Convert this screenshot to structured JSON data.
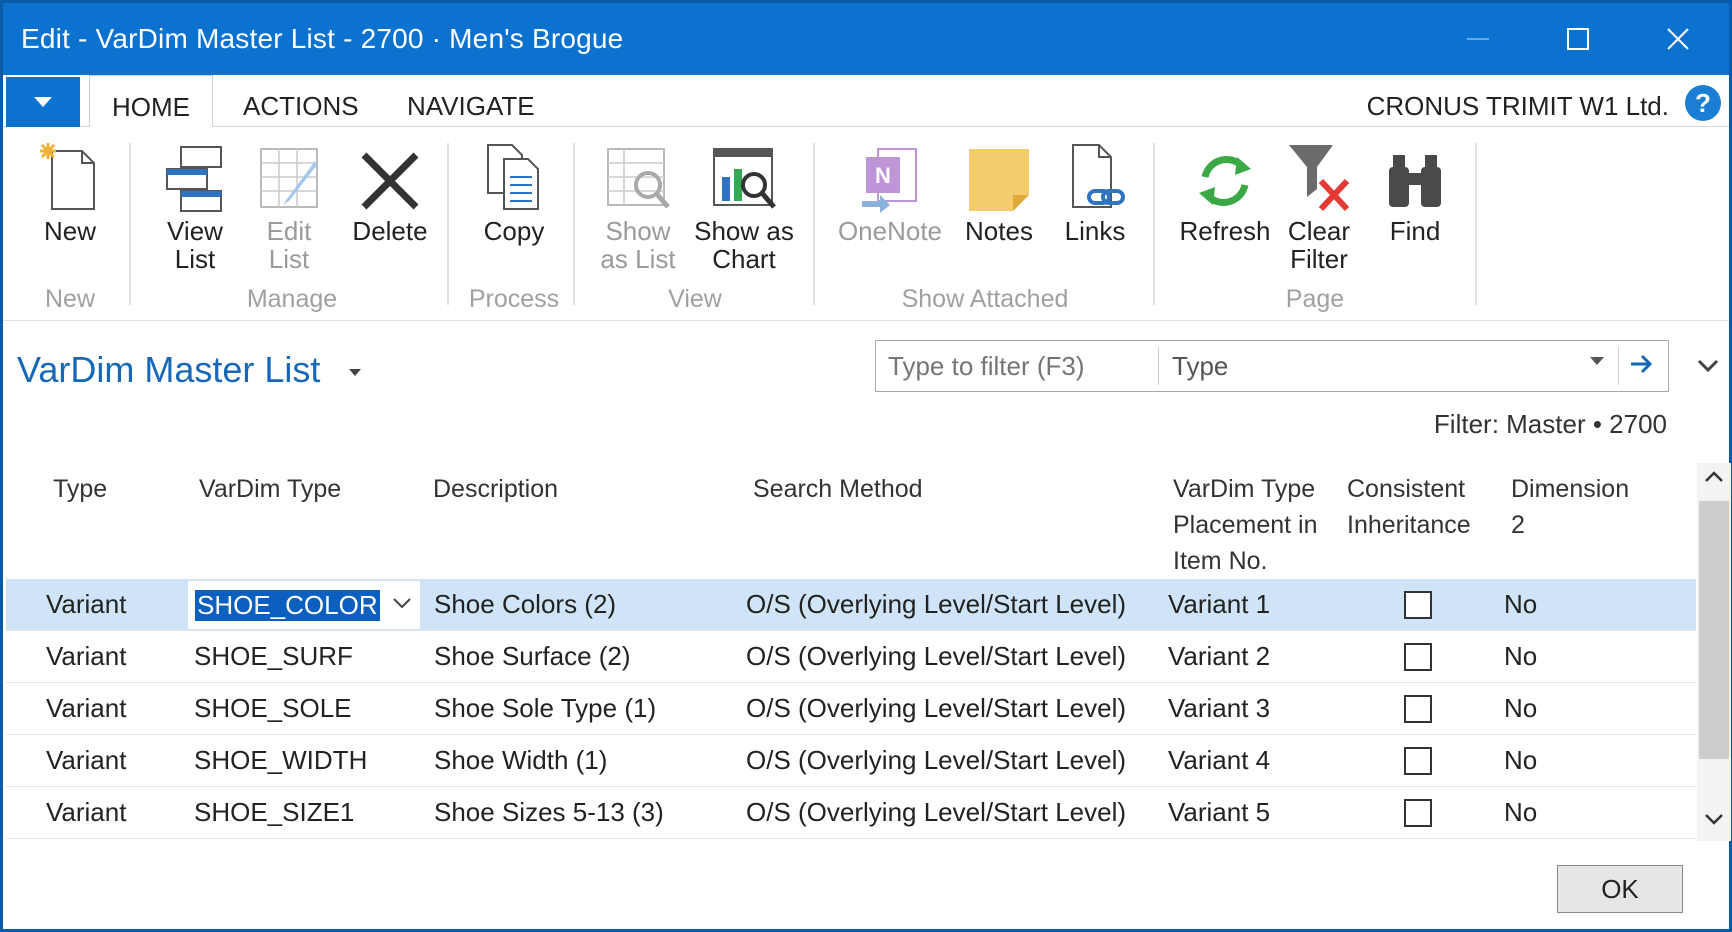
{
  "window": {
    "title": "Edit - VarDim Master List - 2700 · Men's Brogue"
  },
  "tabs": [
    {
      "label": "HOME"
    },
    {
      "label": "ACTIONS"
    },
    {
      "label": "NAVIGATE"
    }
  ],
  "company": "CRONUS TRIMIT W1 Ltd.",
  "help_label": "?",
  "ribbon": {
    "new_group": {
      "label": "New",
      "buttons": [
        {
          "label": "New",
          "icon": "new-document-icon"
        }
      ]
    },
    "manage_group": {
      "label": "Manage",
      "buttons": [
        {
          "label_1": "View",
          "label_2": "List",
          "icon": "view-list-icon"
        },
        {
          "label_1": "Edit",
          "label_2": "List",
          "icon": "edit-list-icon"
        },
        {
          "label": "Delete",
          "icon": "delete-icon"
        }
      ]
    },
    "process_group": {
      "label": "Process",
      "buttons": [
        {
          "label": "Copy",
          "icon": "copy-icon"
        }
      ]
    },
    "view_group": {
      "label": "View",
      "buttons": [
        {
          "label_1": "Show",
          "label_2": "as List",
          "icon": "show-as-list-icon"
        },
        {
          "label_1": "Show as",
          "label_2": "Chart",
          "icon": "show-as-chart-icon"
        }
      ]
    },
    "attached_group": {
      "label": "Show Attached",
      "buttons": [
        {
          "label": "OneNote",
          "icon": "onenote-icon"
        },
        {
          "label": "Notes",
          "icon": "notes-icon"
        },
        {
          "label": "Links",
          "icon": "links-icon"
        }
      ]
    },
    "page_group": {
      "label": "Page",
      "buttons": [
        {
          "label": "Refresh",
          "icon": "refresh-icon"
        },
        {
          "label_1": "Clear",
          "label_2": "Filter",
          "icon": "clear-filter-icon"
        },
        {
          "label": "Find",
          "icon": "find-binoculars-icon"
        }
      ]
    }
  },
  "page": {
    "title": "VarDim Master List",
    "filter_placeholder": "Type to filter (F3)",
    "filter_field": "Type",
    "filter_text": "Filter: Master • 2700"
  },
  "columns": {
    "type": "Type",
    "vardim_type": "VarDim Type",
    "description": "Description",
    "search_method": "Search Method",
    "placement_1": "VarDim Type",
    "placement_2": "Placement in",
    "placement_3": "Item No.",
    "consistent_1": "Consistent",
    "consistent_2": "Inheritance",
    "dimension_1": "Dimension",
    "dimension_2": "2"
  },
  "rows": [
    {
      "type": "Variant",
      "vardim_type": "SHOE_COLOR",
      "description": "Shoe Colors (2)",
      "search_method": "O/S (Overlying Level/Start Level)",
      "placement": "Variant 1",
      "consistent": false,
      "dimension2": "No"
    },
    {
      "type": "Variant",
      "vardim_type": "SHOE_SURF",
      "description": "Shoe Surface (2)",
      "search_method": "O/S (Overlying Level/Start Level)",
      "placement": "Variant 2",
      "consistent": false,
      "dimension2": "No"
    },
    {
      "type": "Variant",
      "vardim_type": "SHOE_SOLE",
      "description": "Shoe Sole Type (1)",
      "search_method": "O/S (Overlying Level/Start Level)",
      "placement": "Variant 3",
      "consistent": false,
      "dimension2": "No"
    },
    {
      "type": "Variant",
      "vardim_type": "SHOE_WIDTH",
      "description": "Shoe Width (1)",
      "search_method": "O/S (Overlying Level/Start Level)",
      "placement": "Variant 4",
      "consistent": false,
      "dimension2": "No"
    },
    {
      "type": "Variant",
      "vardim_type": "SHOE_SIZE1",
      "description": "Shoe Sizes 5-13 (3)",
      "search_method": "O/S (Overlying Level/Start Level)",
      "placement": "Variant 5",
      "consistent": false,
      "dimension2": "No"
    }
  ],
  "ok_label": "OK",
  "colors": {
    "accent": "#0b73cf",
    "selected_row": "#cfe5f7",
    "page_title": "#1769b8"
  }
}
